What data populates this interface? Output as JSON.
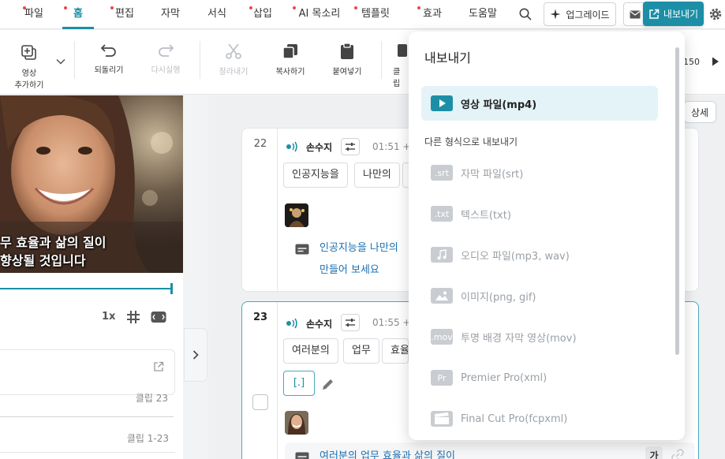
{
  "menu": {
    "items": [
      {
        "label": "파일",
        "dot": true
      },
      {
        "label": "홈",
        "dot": true,
        "active": true
      },
      {
        "label": "편집",
        "dot": true
      },
      {
        "label": "자막",
        "dot": false
      },
      {
        "label": "서식",
        "dot": false
      },
      {
        "label": "삽입",
        "dot": true
      },
      {
        "label": "AI 목소리",
        "dot": true
      },
      {
        "label": "템플릿",
        "dot": true
      },
      {
        "label": "효과",
        "dot": true
      },
      {
        "label": "도움말",
        "dot": false
      }
    ],
    "upgrade_label": "업그레이드",
    "export_label": "내보내기"
  },
  "toolbar": {
    "add_video_line1": "영상",
    "add_video_line2": "추가하기",
    "undo": "되돌리기",
    "redo": "다시실행",
    "cut": "잘라내기",
    "copy": "복사하기",
    "paste": "붙여넣기",
    "clip_partial": "클립",
    "zoom_partial": "150"
  },
  "preview": {
    "caption_line1": "무 효율과 삶의 질이",
    "caption_line2": "향상될 것입니다",
    "speed": "1x",
    "clip_a": "클립 23",
    "clip_b": "클립 1-23"
  },
  "script": {
    "detail_label": "상세",
    "scenes": [
      {
        "number": "22",
        "speaker": "손수지",
        "time": "01:51 +",
        "chips": [
          "인공지능을",
          "나만의"
        ],
        "subtitle_line1": "인공지능을 나만의 ",
        "subtitle_line2": "만들어 보세요"
      },
      {
        "number": "23",
        "speaker": "손수지",
        "time": "01:55 +",
        "chips": [
          "여러분의",
          "업무",
          "효율"
        ],
        "bracket_chip": "[.]",
        "subtitle_line1": "여러분의 업무 효율과 삶의 질이",
        "badge": "가"
      }
    ]
  },
  "export_menu": {
    "title": "내보내기",
    "primary": "영상 파일(mp4)",
    "subheading": "다른 형식으로 내보내기",
    "items": [
      {
        "badge": ".srt",
        "label": "자막 파일(srt)"
      },
      {
        "badge": ".txt",
        "label": "텍스트(txt)"
      },
      {
        "badge": "music-note-icon",
        "label": "오디오 파일(mp3, wav)"
      },
      {
        "badge": "image-icon",
        "label": "이미지(png, gif)"
      },
      {
        "badge": ".mov",
        "label": "투명 배경 자막 영상(mov)"
      },
      {
        "badge": "Pr",
        "label": "Premier Pro(xml)"
      },
      {
        "badge": "clapper-icon",
        "label": "Final Cut Pro(fcpxml)"
      }
    ]
  },
  "colors": {
    "accent": "#1c8fa6",
    "menu_dot": "#e84a4a",
    "primary_highlight": "#e4f3f7",
    "subtitle_text": "#1c6fb0"
  }
}
